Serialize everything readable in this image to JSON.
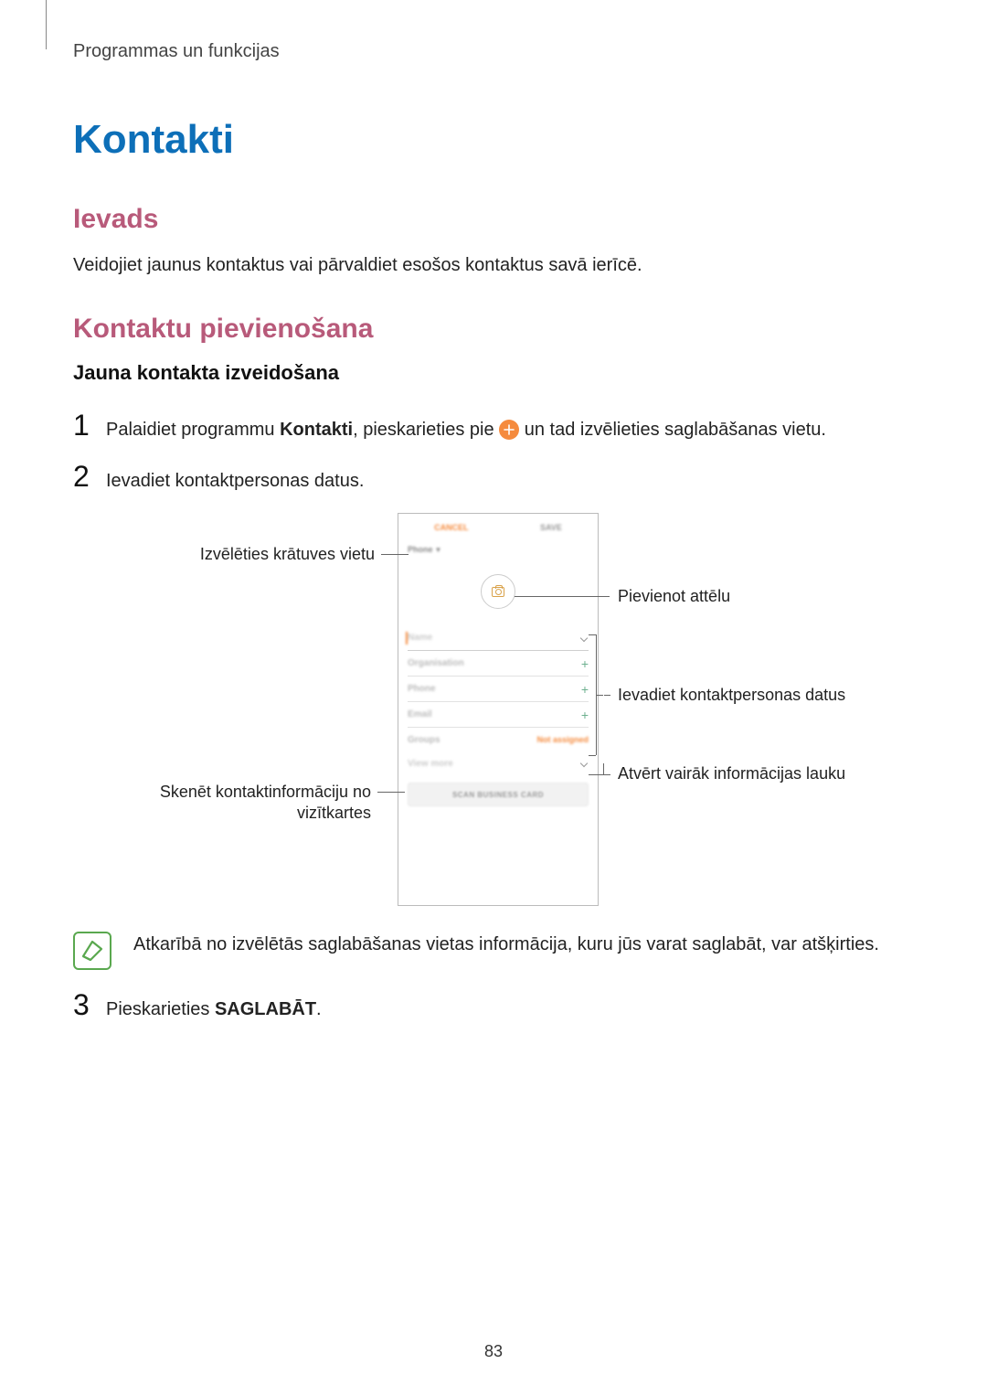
{
  "breadcrumb": "Programmas un funkcijas",
  "title": "Kontakti",
  "section_intro_heading": "Ievads",
  "section_intro_body": "Veidojiet jaunus kontaktus vai pārvaldiet esošos kontaktus savā ierīcē.",
  "section_add_heading": "Kontaktu pievienošana",
  "subsection_create_heading": "Jauna kontakta izveidošana",
  "steps": {
    "s1": {
      "num": "1",
      "pre": "Palaidiet programmu ",
      "bold": "Kontakti",
      "mid": ", pieskarieties pie ",
      "post": " un tad izvēlieties saglabāšanas vietu."
    },
    "s2": {
      "num": "2",
      "text": "Ievadiet kontaktpersonas datus."
    },
    "s3": {
      "num": "3",
      "pre": "Pieskarieties ",
      "bold": "SAGLABĀT",
      "post": "."
    }
  },
  "callouts": {
    "storage": "Izvēlēties krātuves vietu",
    "add_image": "Pievienot attēlu",
    "enter_data": "Ievadiet kontaktpersonas datus",
    "open_more": "Atvērt vairāk informācijas lauku",
    "scan_card": "Skenēt kontaktinformāciju no vizītkartes"
  },
  "phone": {
    "cancel": "CANCEL",
    "save": "SAVE",
    "storage": "Phone",
    "name": "Name",
    "org": "Organisation",
    "phone": "Phone",
    "email": "Email",
    "groups": "Groups",
    "not_assigned": "Not assigned",
    "view_more": "View more",
    "scan": "SCAN BUSINESS CARD"
  },
  "note_text": "Atkarībā no izvēlētās saglabāšanas vietas informācija, kuru jūs varat saglabāt, var atšķirties.",
  "page_number": "83"
}
